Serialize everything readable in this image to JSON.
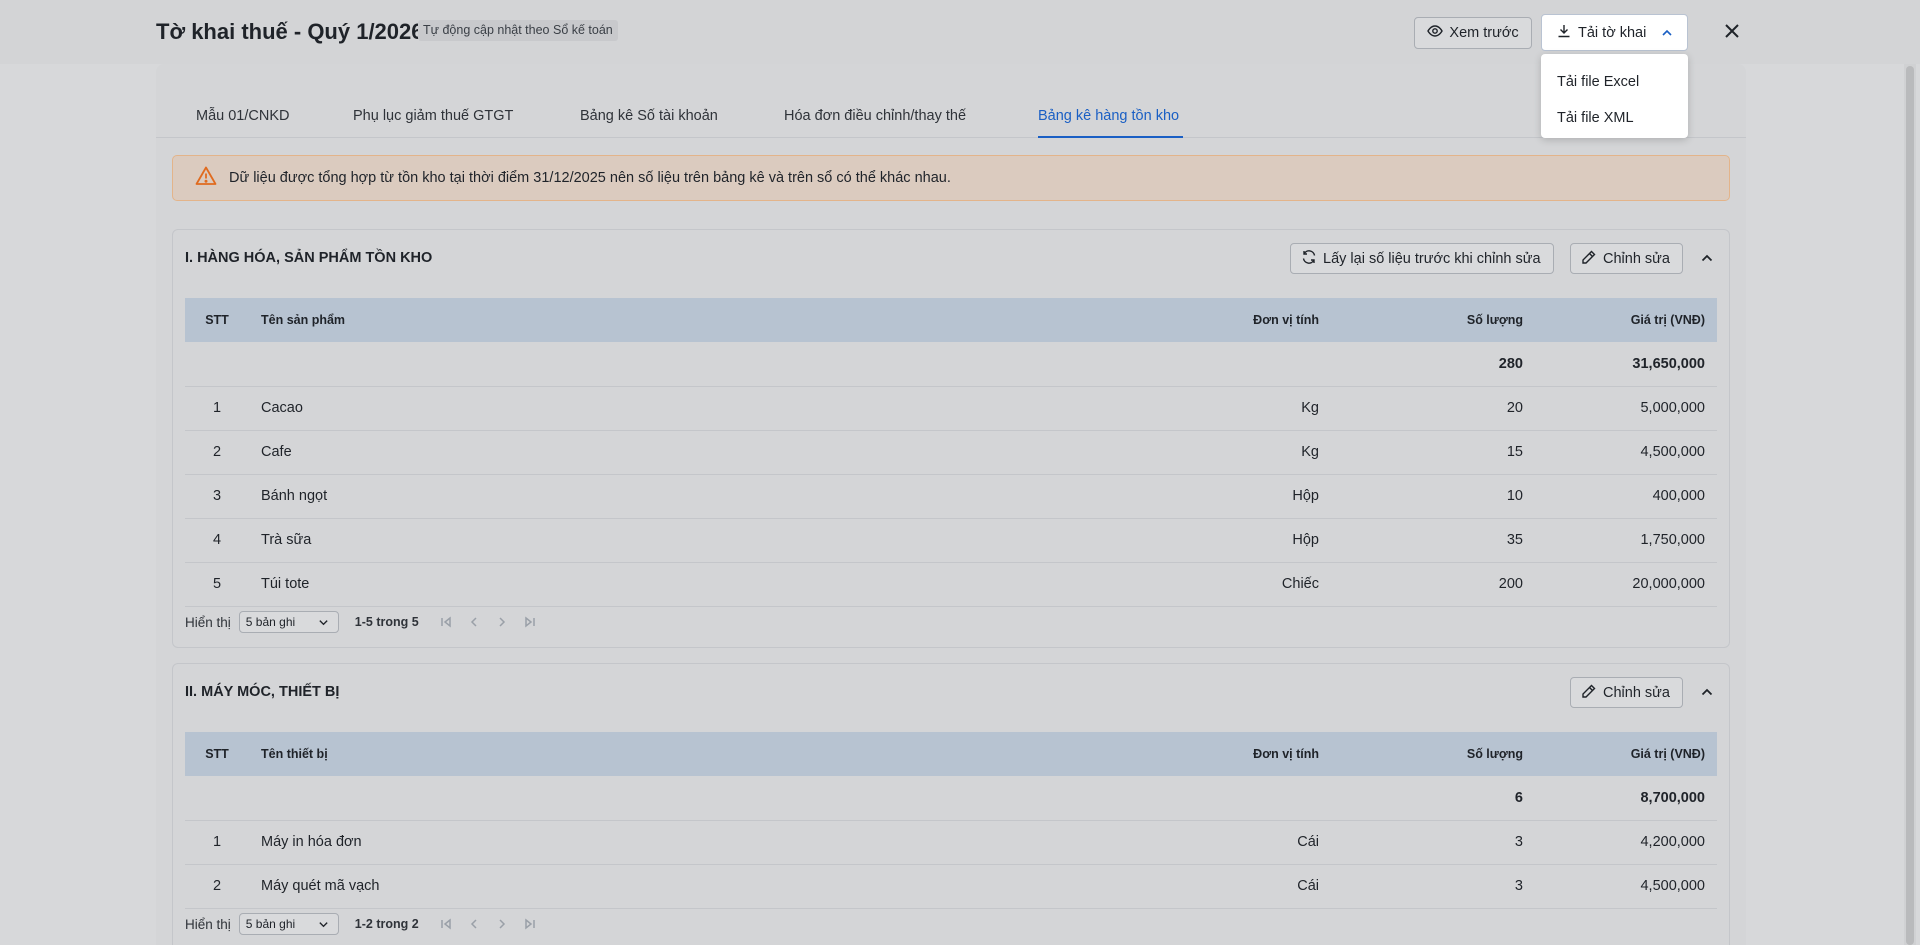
{
  "header": {
    "title": "Tờ khai thuế - Quý 1/2026",
    "badge": "Tự động cập nhật theo Sổ kế toán",
    "preview_label": "Xem trước",
    "download_label": "Tải tờ khai"
  },
  "dropdown": {
    "items": [
      "Tải file Excel",
      "Tải file XML"
    ]
  },
  "tabs": [
    {
      "label": "Mẫu 01/CNKD",
      "active": false
    },
    {
      "label": "Phụ lục giảm thuế GTGT",
      "active": false
    },
    {
      "label": "Bảng kê Số tài khoản",
      "active": false
    },
    {
      "label": "Hóa đơn điều chỉnh/thay thế",
      "active": false
    },
    {
      "label": "Bảng kê hàng tồn kho",
      "active": true
    }
  ],
  "alert": {
    "text": "Dữ liệu được tổng hợp từ tồn kho tại thời điểm 31/12/2025 nên số liệu trên bảng kê và trên sổ có thể khác nhau."
  },
  "section1": {
    "title": "I. HÀNG HÓA, SẢN PHẨM TỒN KHO",
    "refresh_label": "Lấy lại số liệu trước khi chỉnh sửa",
    "edit_label": "Chỉnh sửa",
    "columns": [
      "STT",
      "Tên sản phẩm",
      "Đơn vị tính",
      "Số lượng",
      "Giá trị (VNĐ)"
    ],
    "total": {
      "qty": "280",
      "value": "31,650,000"
    },
    "rows": [
      {
        "stt": "1",
        "name": "Cacao",
        "unit": "Kg",
        "qty": "20",
        "value": "5,000,000"
      },
      {
        "stt": "2",
        "name": "Cafe",
        "unit": "Kg",
        "qty": "15",
        "value": "4,500,000"
      },
      {
        "stt": "3",
        "name": "Bánh ngọt",
        "unit": "Hộp",
        "qty": "10",
        "value": "400,000"
      },
      {
        "stt": "4",
        "name": "Trà sữa",
        "unit": "Hộp",
        "qty": "35",
        "value": "1,750,000"
      },
      {
        "stt": "5",
        "name": "Túi tote",
        "unit": "Chiếc",
        "qty": "200",
        "value": "20,000,000"
      }
    ],
    "pager": {
      "label": "Hiển thị",
      "page_size": "5 bản ghi",
      "range": "1-5 trong 5"
    }
  },
  "section2": {
    "title": "II. MÁY MÓC, THIẾT BỊ",
    "edit_label": "Chỉnh sửa",
    "columns": [
      "STT",
      "Tên thiết bị",
      "Đơn vị tính",
      "Số lượng",
      "Giá trị (VNĐ)"
    ],
    "total": {
      "qty": "6",
      "value": "8,700,000"
    },
    "rows": [
      {
        "stt": "1",
        "name": "Máy in hóa đơn",
        "unit": "Cái",
        "qty": "3",
        "value": "4,200,000"
      },
      {
        "stt": "2",
        "name": "Máy quét mã vạch",
        "unit": "Cái",
        "qty": "3",
        "value": "4,500,000"
      }
    ],
    "pager": {
      "label": "Hiển thị",
      "page_size": "5 bản ghi",
      "range": "1-2 trong 2"
    }
  },
  "colors": {
    "accent": "#1a5fc4",
    "table_header": "#b7c3d1",
    "alert_border": "#e3b48a",
    "warning": "#e06b1f"
  }
}
